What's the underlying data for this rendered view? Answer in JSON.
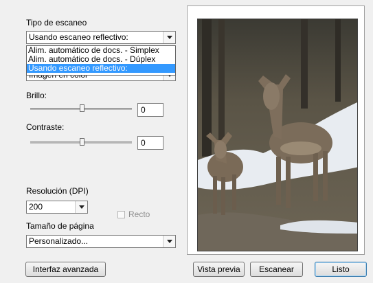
{
  "scan_type": {
    "label": "Tipo de escaneo",
    "selected": "Usando escaneo reflectivo:",
    "options": [
      "Alim. automático de docs. - Simplex",
      "Alim. automático de docs. - Dúplex",
      "Usando escaneo reflectivo:"
    ],
    "hidden_partial": "Imagen en color"
  },
  "brightness": {
    "label": "Brillo:",
    "value": "0",
    "level": 0.5
  },
  "contrast": {
    "label": "Contraste:",
    "value": "0",
    "level": 0.5
  },
  "resolution": {
    "label": "Resolución (DPI)",
    "value": "200"
  },
  "straight": {
    "label": "Recto",
    "checked": false
  },
  "page_size": {
    "label": "Tamaño de página",
    "value": "Personalizado..."
  },
  "buttons": {
    "advanced": "Interfaz avanzada",
    "preview": "Vista previa",
    "scan": "Escanear",
    "done": "Listo"
  },
  "preview_image": {
    "subject": "deer-photo",
    "colors": {
      "sky": "#cfd8df",
      "snow": "#eef1f5",
      "deer": "#7a6a58",
      "ground": "#6b6356"
    }
  }
}
